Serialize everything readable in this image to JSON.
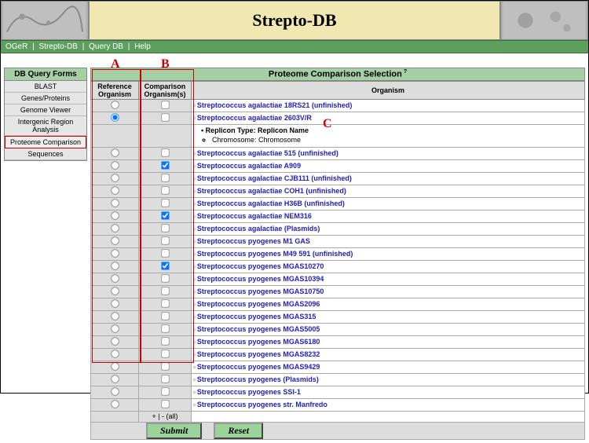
{
  "header": {
    "title": "Strepto-DB"
  },
  "nav": {
    "items": [
      "OGeR",
      "Strepto-DB",
      "Query DB",
      "Help"
    ],
    "sep": " | "
  },
  "sidebar": {
    "title": "DB Query Forms",
    "items": [
      {
        "label": "BLAST"
      },
      {
        "label": "Genes/Proteins"
      },
      {
        "label": "Genome Viewer"
      },
      {
        "label": "Intergenic Region Analysis"
      },
      {
        "label": "Proteome Comparison",
        "active": true
      },
      {
        "label": "Sequences"
      }
    ]
  },
  "main": {
    "title": "Proteome Comparison Selection",
    "cols": {
      "ref": "Reference Organism",
      "cmp": "Comparison Organism(s)",
      "org": "Organism"
    },
    "replicon": {
      "heading": "Replicon Type: Replicon Name",
      "item": "Chromosome: Chromosome"
    },
    "rows": [
      {
        "org": "Streptococcus agalactiae 18RS21 (unfinished)",
        "ref": false,
        "cmp": false,
        "expanded": false
      },
      {
        "org": "Streptococcus agalactiae 2603V/R",
        "ref": true,
        "cmp": false,
        "expanded": true
      },
      {
        "org": "Streptococcus agalactiae 515 (unfinished)",
        "ref": false,
        "cmp": false
      },
      {
        "org": "Streptococcus agalactiae A909",
        "ref": false,
        "cmp": true
      },
      {
        "org": "Streptococcus agalactiae CJB111 (unfinished)",
        "ref": false,
        "cmp": false
      },
      {
        "org": "Streptococcus agalactiae COH1 (unfinished)",
        "ref": false,
        "cmp": false
      },
      {
        "org": "Streptococcus agalactiae H36B (unfinished)",
        "ref": false,
        "cmp": false
      },
      {
        "org": "Streptococcus agalactiae NEM316",
        "ref": false,
        "cmp": true
      },
      {
        "org": "Streptococcus agalactiae (Plasmids)",
        "ref": false,
        "cmp": false
      },
      {
        "org": "Streptococcus pyogenes M1 GAS",
        "ref": false,
        "cmp": false
      },
      {
        "org": "Streptococcus pyogenes M49 591 (unfinished)",
        "ref": false,
        "cmp": false
      },
      {
        "org": "Streptococcus pyogenes MGAS10270",
        "ref": false,
        "cmp": true
      },
      {
        "org": "Streptococcus pyogenes MGAS10394",
        "ref": false,
        "cmp": false
      },
      {
        "org": "Streptococcus pyogenes MGAS10750",
        "ref": false,
        "cmp": false
      },
      {
        "org": "Streptococcus pyogenes MGAS2096",
        "ref": false,
        "cmp": false
      },
      {
        "org": "Streptococcus pyogenes MGAS315",
        "ref": false,
        "cmp": false
      },
      {
        "org": "Streptococcus pyogenes MGAS5005",
        "ref": false,
        "cmp": false
      },
      {
        "org": "Streptococcus pyogenes MGAS6180",
        "ref": false,
        "cmp": false
      },
      {
        "org": "Streptococcus pyogenes MGAS8232",
        "ref": false,
        "cmp": false
      },
      {
        "org": "Streptococcus pyogenes MGAS9429",
        "ref": false,
        "cmp": false
      },
      {
        "org": "Streptococcus pyogenes (Plasmids)",
        "ref": false,
        "cmp": false
      },
      {
        "org": "Streptococcus pyogenes SSI-1",
        "ref": false,
        "cmp": false
      },
      {
        "org": "Streptococcus pyogenes str. Manfredo",
        "ref": false,
        "cmp": false
      }
    ],
    "all_toggle": "+ | - (all)",
    "buttons": {
      "submit": "Submit",
      "reset": "Reset"
    }
  },
  "annotations": {
    "A": "A",
    "B": "B",
    "C": "C"
  }
}
